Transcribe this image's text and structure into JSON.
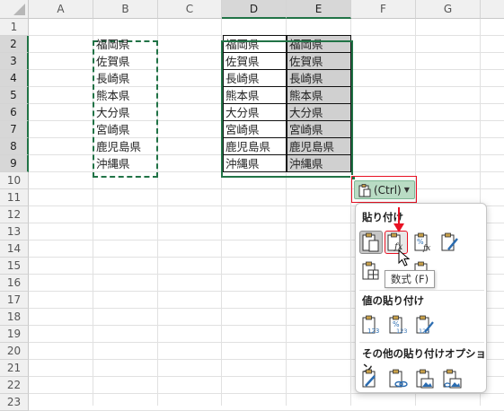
{
  "sheet": {
    "columns": [
      "A",
      "B",
      "C",
      "D",
      "E",
      "F",
      "G"
    ],
    "rows": [
      "1",
      "2",
      "3",
      "4",
      "5",
      "6",
      "7",
      "8",
      "9",
      "10",
      "11",
      "12",
      "13",
      "14",
      "15",
      "16",
      "17",
      "18",
      "19",
      "20",
      "21",
      "22",
      "23"
    ],
    "column_b": [
      "福岡県",
      "佐賀県",
      "長崎県",
      "熊本県",
      "大分県",
      "宮崎県",
      "鹿児島県",
      "沖縄県"
    ],
    "column_d": [
      "福岡県",
      "佐賀県",
      "長崎県",
      "熊本県",
      "大分県",
      "宮崎県",
      "鹿児島県",
      "沖縄県"
    ],
    "column_e": [
      "福岡県",
      "佐賀県",
      "長崎県",
      "熊本県",
      "大分県",
      "宮崎県",
      "鹿児島県",
      "沖縄県"
    ]
  },
  "paste_options": {
    "button_label": "(Ctrl)",
    "section_paste": "貼り付け",
    "section_values": "値の貼り付け",
    "section_other": "その他の貼り付けオプション",
    "tooltip": "数式 (F)"
  },
  "colors": {
    "selection_green": "#217346",
    "highlight_red": "#e81123",
    "copied_fill": "#d0d0d0"
  }
}
